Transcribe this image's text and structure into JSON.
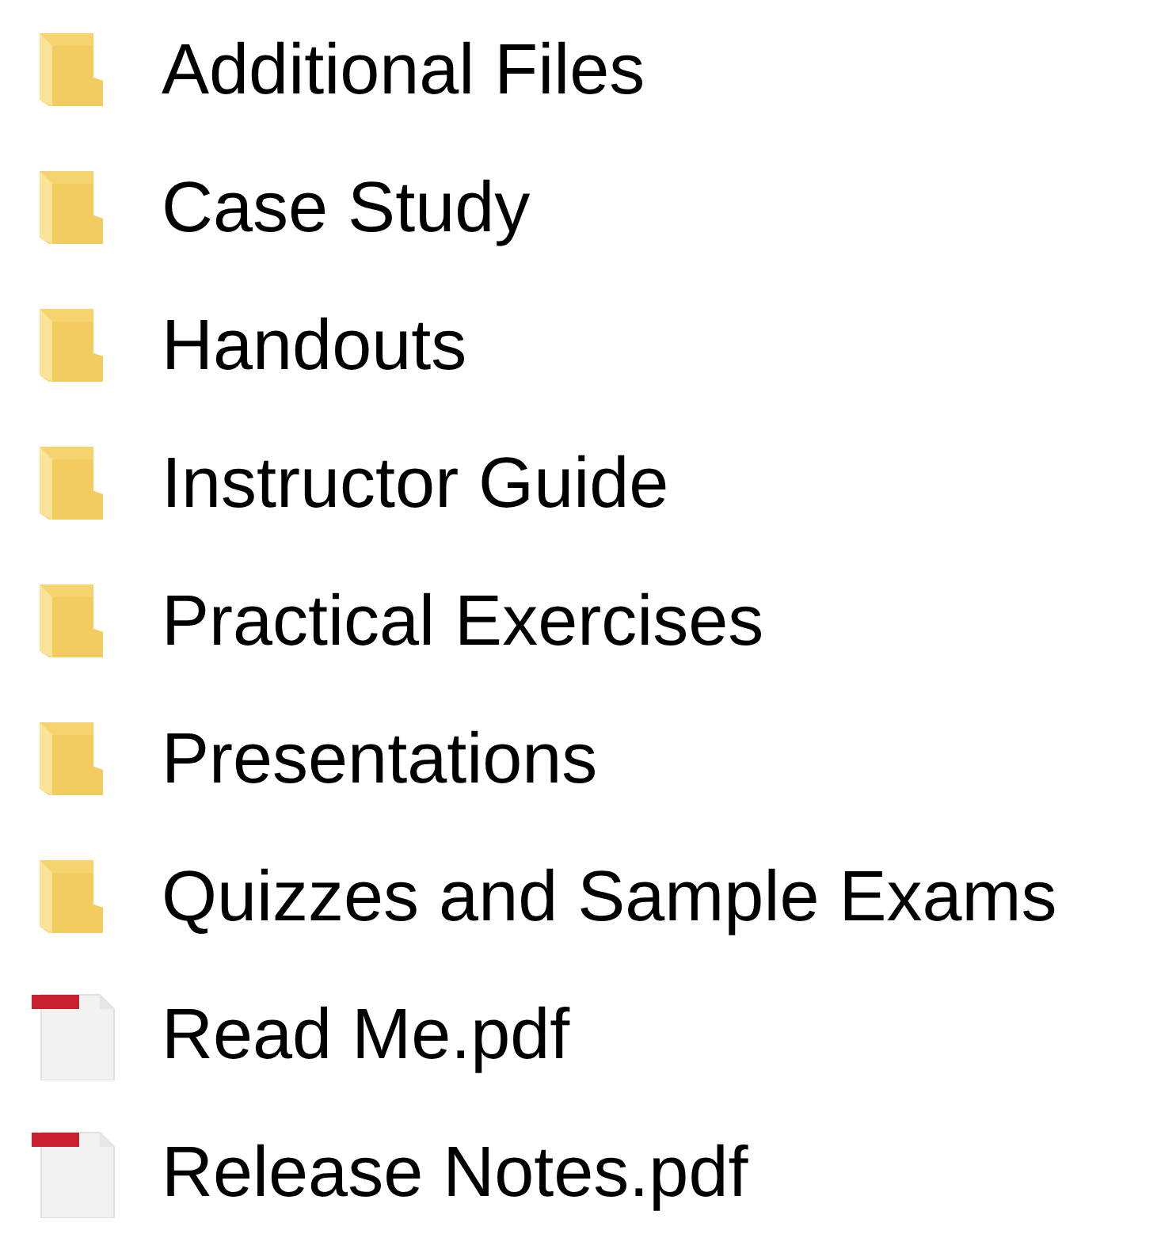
{
  "items": [
    {
      "kind": "folder",
      "name": "Additional Files"
    },
    {
      "kind": "folder",
      "name": "Case Study"
    },
    {
      "kind": "folder",
      "name": "Handouts"
    },
    {
      "kind": "folder",
      "name": "Instructor Guide"
    },
    {
      "kind": "folder",
      "name": "Practical Exercises"
    },
    {
      "kind": "folder",
      "name": "Presentations"
    },
    {
      "kind": "folder",
      "name": "Quizzes and Sample Exams"
    },
    {
      "kind": "pdf",
      "name": "Read Me.pdf"
    },
    {
      "kind": "pdf",
      "name": "Release Notes.pdf"
    }
  ]
}
